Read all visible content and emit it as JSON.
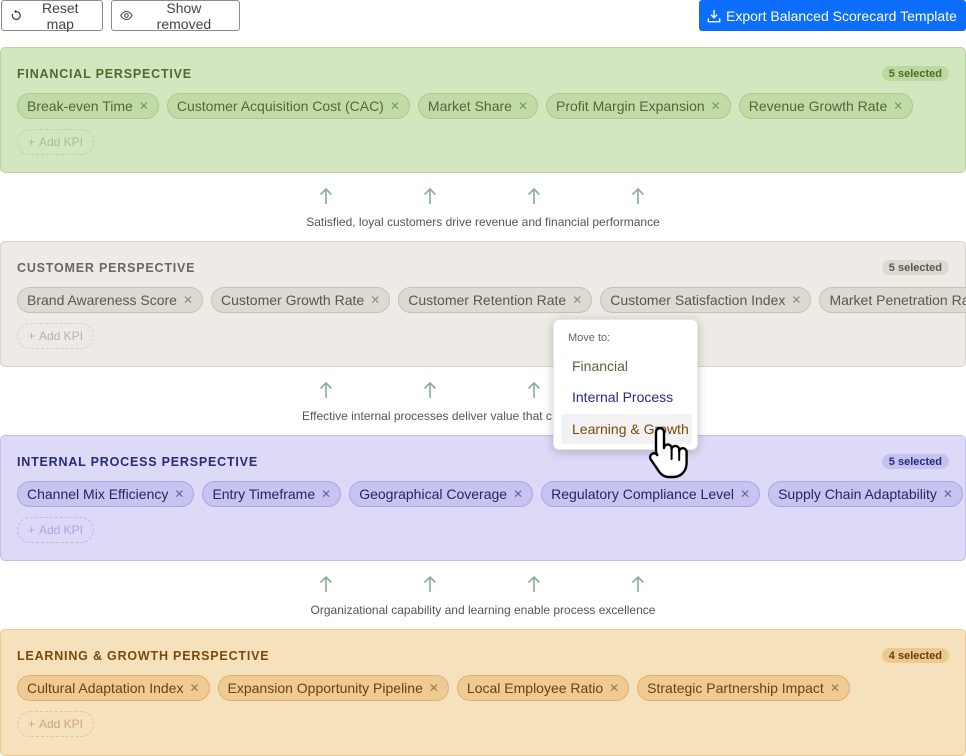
{
  "toolbar": {
    "reset_label": "Reset map",
    "show_removed_label": "Show removed",
    "export_label": "Export Balanced Scorecard Template"
  },
  "perspectives": [
    {
      "title": "FINANCIAL PERSPECTIVE",
      "badge": "5 selected",
      "kpis": [
        "Break-even Time",
        "Customer Acquisition Cost (CAC)",
        "Market Share",
        "Profit Margin Expansion",
        "Revenue Growth Rate"
      ],
      "add_label": "Add KPI"
    },
    {
      "title": "CUSTOMER PERSPECTIVE",
      "badge": "5 selected",
      "kpis": [
        "Brand Awareness Score",
        "Customer Growth Rate",
        "Customer Retention Rate",
        "Customer Satisfaction Index",
        "Market Penetration Rate"
      ],
      "add_label": "Add KPI"
    },
    {
      "title": "INTERNAL PROCESS PERSPECTIVE",
      "badge": "5 selected",
      "kpis": [
        "Channel Mix Efficiency",
        "Entry Timeframe",
        "Geographical Coverage",
        "Regulatory Compliance Level",
        "Supply Chain Adaptability"
      ],
      "add_label": "Add KPI"
    },
    {
      "title": "LEARNING & GROWTH PERSPECTIVE",
      "badge": "4 selected",
      "kpis": [
        "Cultural Adaptation Index",
        "Expansion Opportunity Pipeline",
        "Local Employee Ratio",
        "Strategic Partnership Impact"
      ],
      "add_label": "Add KPI"
    }
  ],
  "connectors": [
    "Satisfied, loyal customers drive revenue and financial performance",
    "Effective internal processes deliver value that c",
    "Organizational capability and learning enable process excellence"
  ],
  "move_menu": {
    "title": "Move to:",
    "items": [
      "Financial",
      "Internal Process",
      "Learning & Growth"
    ]
  },
  "icons": {
    "reset": "reset-icon",
    "show_removed": "eye-icon",
    "export": "download-icon",
    "remove": "close-icon",
    "add": "plus-icon",
    "arrow": "arrow-up-icon",
    "cursor": "hand-pointer-icon"
  },
  "colors": {
    "export_button": "#0d6efd",
    "financial": "#d4e6c0",
    "customer": "#eeebe6",
    "internal": "#dcdaf7",
    "learning": "#f6e1bd",
    "arrow": "#86b196"
  }
}
